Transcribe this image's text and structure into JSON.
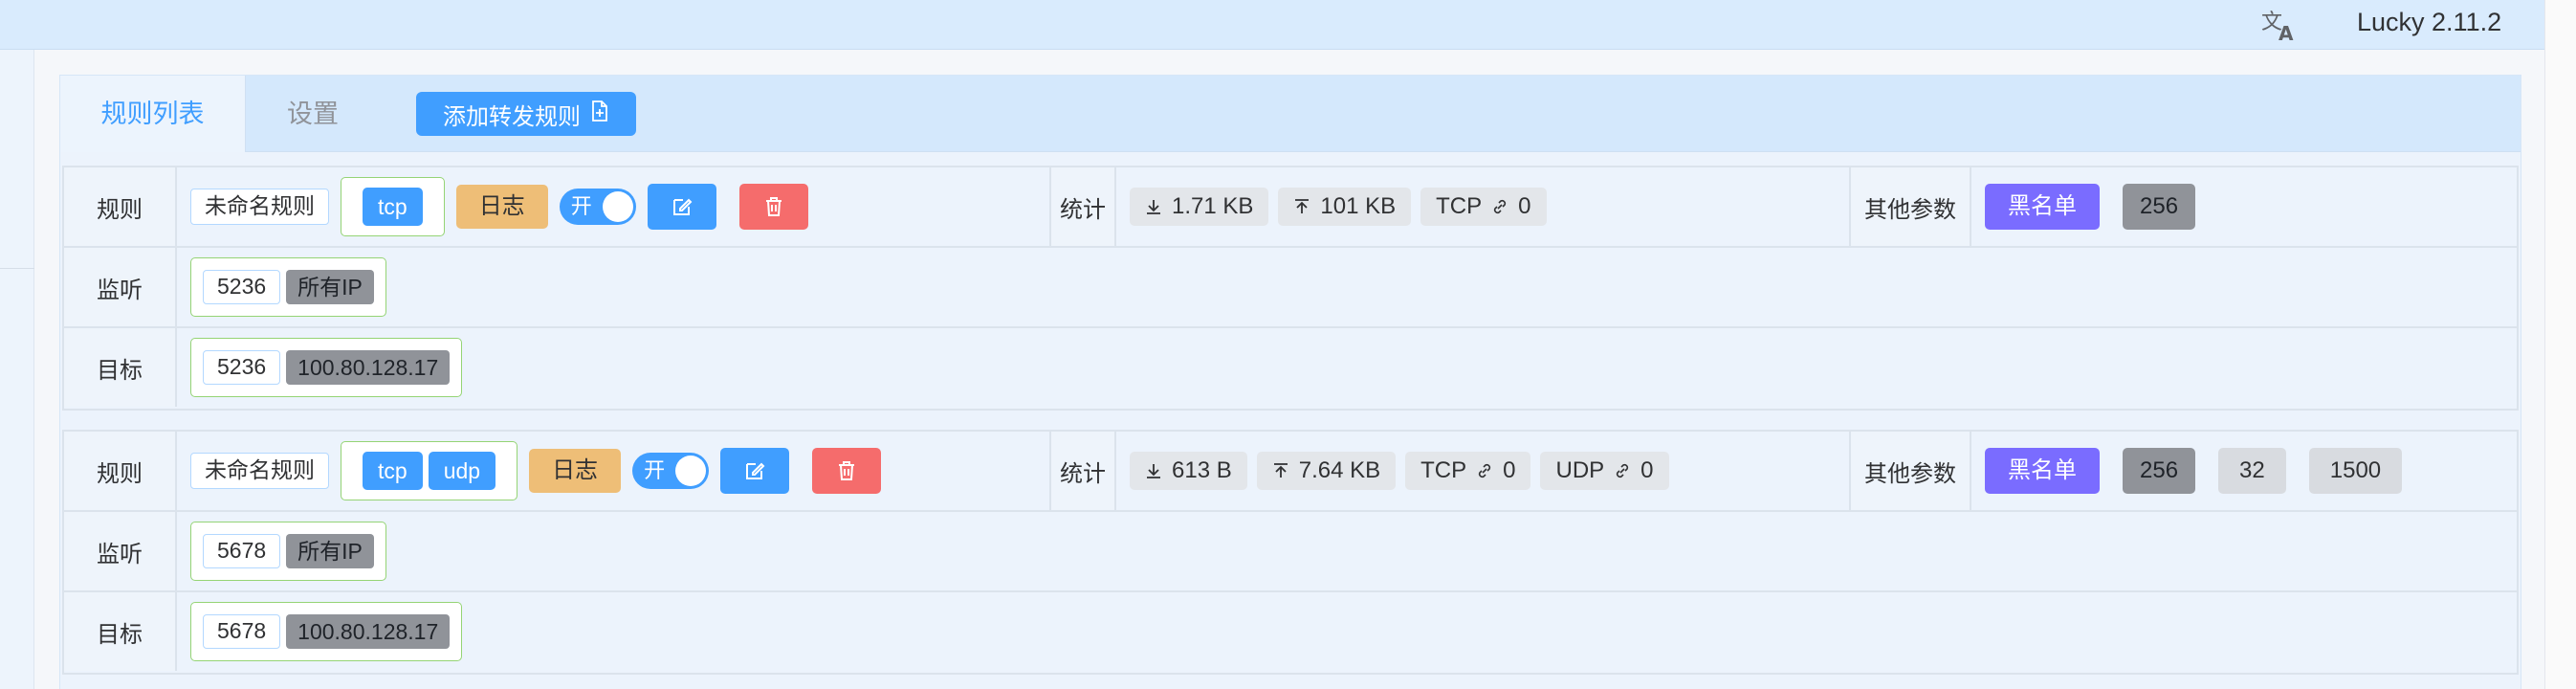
{
  "header": {
    "version": "Lucky 2.11.2",
    "translate_icon": "translate-icon"
  },
  "tabs": [
    {
      "label": "规则列表",
      "active": true
    },
    {
      "label": "设置",
      "active": false
    }
  ],
  "add_button": {
    "label": "添加转发规则",
    "icon": "add-document-icon"
  },
  "labels": {
    "rule": "规则",
    "listen": "监听",
    "target": "目标",
    "stats": "统计",
    "other": "其他参数",
    "log": "日志",
    "toggle": "开",
    "blacklist": "黑名单"
  },
  "rules": [
    {
      "name": "未命名规则",
      "protocols": [
        "tcp"
      ],
      "enabled": true,
      "stats": {
        "download": "1.71 KB",
        "upload": "101 KB",
        "tcp_label": "TCP",
        "tcp_conns": "0"
      },
      "other": {
        "first": "256"
      },
      "listen": {
        "port": "5236",
        "ip": "所有IP"
      },
      "target": {
        "port": "5236",
        "ip": "100.80.128.17"
      }
    },
    {
      "name": "未命名规则",
      "protocols": [
        "tcp",
        "udp"
      ],
      "enabled": true,
      "stats": {
        "download": "613 B",
        "upload": "7.64 KB",
        "tcp_label": "TCP",
        "tcp_conns": "0",
        "udp_label": "UDP",
        "udp_conns": "0"
      },
      "other": {
        "first": "256",
        "second": "32",
        "third": "1500"
      },
      "listen": {
        "port": "5678",
        "ip": "所有IP"
      },
      "target": {
        "port": "5678",
        "ip": "100.80.128.17"
      }
    }
  ],
  "colors": {
    "primary": "#409eff",
    "danger": "#f56c6c",
    "warning": "#eebe77",
    "blacklist": "#7a6cff",
    "header_bg": "#d9ebfd"
  }
}
